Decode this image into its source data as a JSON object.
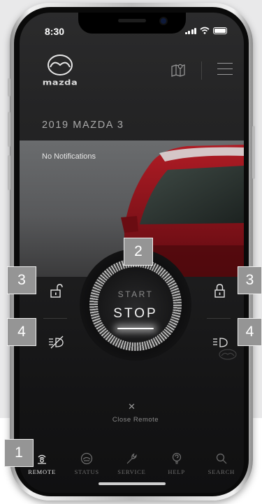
{
  "status_bar": {
    "time": "8:30"
  },
  "brand": {
    "name": "mazda"
  },
  "vehicle": {
    "name": "2019 MAZDA 3"
  },
  "notifications": {
    "text": "No Notifications"
  },
  "engine": {
    "start_label": "START",
    "stop_label": "STOP"
  },
  "close": {
    "label": "Close Remote"
  },
  "tabs": [
    {
      "label": "REMOTE",
      "icon": "remote-signal-icon",
      "active": true
    },
    {
      "label": "STATUS",
      "icon": "status-car-icon",
      "active": false
    },
    {
      "label": "SERVICE",
      "icon": "wrench-icon",
      "active": false
    },
    {
      "label": "HELP",
      "icon": "help-icon",
      "active": false
    },
    {
      "label": "SEARCH",
      "icon": "search-icon",
      "active": false
    }
  ],
  "callouts": {
    "tabbar": "1",
    "engine": "2",
    "unlock": "3",
    "lock": "3",
    "lights_off": "4",
    "lights_on": "4"
  },
  "colors": {
    "callout_bg": "#959595",
    "screen_bg": "#1e1e1f",
    "hero_car": "#8c1019",
    "active_tab": "#e6e6e6"
  }
}
